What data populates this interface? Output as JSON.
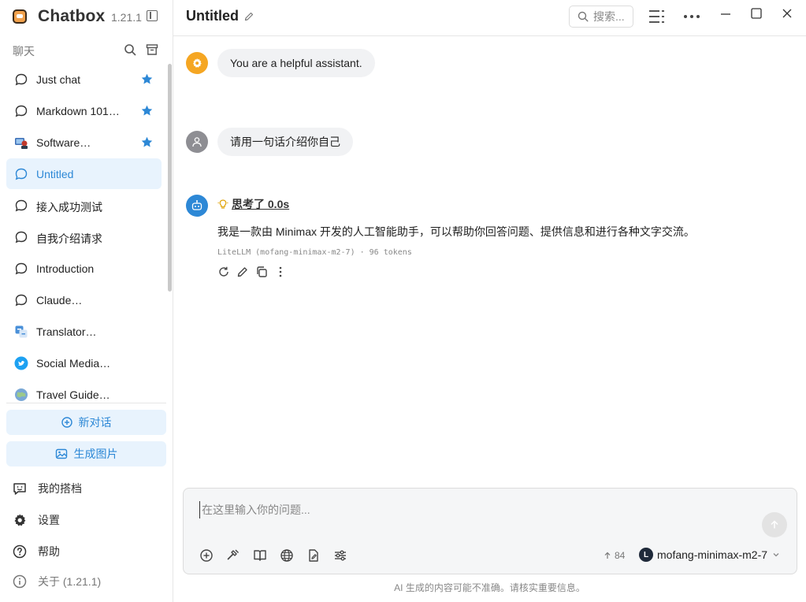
{
  "app": {
    "name": "Chatbox",
    "version": "1.21.1"
  },
  "sidebar": {
    "section_label": "聊天",
    "chats": [
      {
        "label": "Just chat",
        "starred": true,
        "icon": "chat-bubble-icon"
      },
      {
        "label": "Markdown 101…",
        "starred": true,
        "icon": "chat-bubble-icon"
      },
      {
        "label": "Software…",
        "starred": true,
        "icon": "software-developer-avatar-icon"
      },
      {
        "label": "Untitled",
        "starred": false,
        "active": true,
        "icon": "chat-bubble-icon"
      },
      {
        "label": "接入成功测试",
        "starred": false,
        "icon": "chat-bubble-icon"
      },
      {
        "label": "自我介绍请求",
        "starred": false,
        "icon": "chat-bubble-icon"
      },
      {
        "label": "Introduction",
        "starred": false,
        "icon": "chat-bubble-icon"
      },
      {
        "label": "Claude…",
        "starred": false,
        "icon": "chat-bubble-icon"
      },
      {
        "label": "Translator…",
        "starred": false,
        "icon": "translator-avatar-icon"
      },
      {
        "label": "Social Media…",
        "starred": false,
        "icon": "twitter-avatar-icon"
      },
      {
        "label": "Travel Guide…",
        "starred": false,
        "icon": "globe-avatar-icon"
      }
    ],
    "new_chat_label": "新对话",
    "generate_image_label": "生成图片",
    "menu": {
      "partners": "我的搭档",
      "settings": "设置",
      "help": "帮助",
      "about": "关于 (1.21.1)"
    }
  },
  "header": {
    "title": "Untitled",
    "search_placeholder": "搜索..."
  },
  "messages": [
    {
      "role": "system",
      "text": "You are a helpful assistant."
    },
    {
      "role": "user",
      "text": "请用一句话介绍你自己"
    },
    {
      "role": "assistant",
      "thinking_label": "思考了 0.0s",
      "text": "我是一款由 Minimax 开发的人工智能助手，可以帮助你回答问题、提供信息和进行各种文字交流。",
      "meta": "LiteLLM (mofang-minimax-m2-7) · 96 tokens"
    }
  ],
  "composer": {
    "placeholder": "在这里输入你的问题...",
    "token_count": "84",
    "model_badge": "L",
    "model_name": "mofang-minimax-m2-7"
  },
  "disclaimer": "AI 生成的内容可能不准确。请核实重要信息。",
  "colors": {
    "accent": "#2d88d6",
    "active_bg": "#e8f3fd",
    "system_avatar": "#f5a623",
    "user_avatar": "#8e8e93",
    "assistant_avatar": "#2d88d6"
  }
}
